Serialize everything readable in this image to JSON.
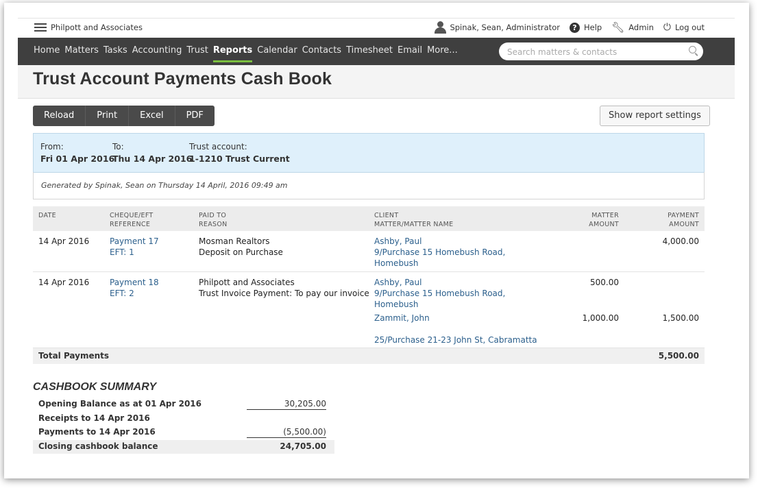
{
  "topbar": {
    "firm": "Philpott and Associates",
    "user": "Spinak, Sean, Administrator",
    "help": "Help",
    "admin": "Admin",
    "logout": "Log out"
  },
  "nav": {
    "items": [
      "Home",
      "Matters",
      "Tasks",
      "Accounting",
      "Trust",
      "Reports",
      "Calendar",
      "Contacts",
      "Timesheet",
      "Email",
      "More..."
    ],
    "active": "Reports",
    "search_placeholder": "Search matters & contacts"
  },
  "page": {
    "title": "Trust Account Payments Cash Book"
  },
  "toolbar": {
    "buttons": [
      "Reload",
      "Print",
      "Excel",
      "PDF"
    ],
    "settings": "Show report settings"
  },
  "criteria": {
    "from_label": "From:",
    "from_value": "Fri 01 Apr 2016",
    "to_label": "To:",
    "to_value": "Thu 14 Apr 2016",
    "account_label": "Trust account:",
    "account_value": "1-1210 Trust Current"
  },
  "generated": "Generated by Spinak, Sean on Thursday 14 April, 2016 09:49 am",
  "table": {
    "headers": {
      "date": "DATE",
      "ref1": "CHEQUE/EFT",
      "ref2": "REFERENCE",
      "paid1": "PAID TO",
      "paid2": "REASON",
      "client1": "CLIENT",
      "client2": "MATTER/MATTER NAME",
      "mamt1": "MATTER",
      "mamt2": "AMOUNT",
      "pamt1": "PAYMENT",
      "pamt2": "AMOUNT"
    },
    "rows": [
      {
        "date": "14 Apr 2016",
        "ref": "Payment 17",
        "eft": "EFT: 1",
        "paid_to": "Mosman Realtors",
        "reason": "Deposit on Purchase",
        "client": "Ashby, Paul",
        "matter_l1": "9/Purchase 15 Homebush Road,",
        "matter_l2": "Homebush",
        "matter_amount": "",
        "payment_amount": "4,000.00"
      },
      {
        "date": "14 Apr 2016",
        "ref": "Payment 18",
        "eft": "EFT: 2",
        "paid_to": "Philpott and Associates",
        "reason": "Trust Invoice Payment: To pay our invoice",
        "client": "Ashby, Paul",
        "matter_l1": "9/Purchase 15 Homebush Road,",
        "matter_l2": "Homebush",
        "matter_amount": "500.00",
        "client2": "Zammit, John",
        "matter2": "25/Purchase 21-23 John St, Cabramatta",
        "matter_amount2": "1,000.00",
        "payment_amount": "1,500.00"
      }
    ],
    "total_label": "Total Payments",
    "total_value": "5,500.00"
  },
  "summary": {
    "title": "CASHBOOK SUMMARY",
    "opening_label": "Opening Balance as at 01 Apr 2016",
    "opening_value": "30,205.00",
    "receipts_label": "Receipts to 14 Apr 2016",
    "receipts_value": "",
    "payments_label": "Payments to 14 Apr 2016",
    "payments_value": "(5,500.00)",
    "closing_label": "Closing cashbook balance",
    "closing_value": "24,705.00"
  }
}
